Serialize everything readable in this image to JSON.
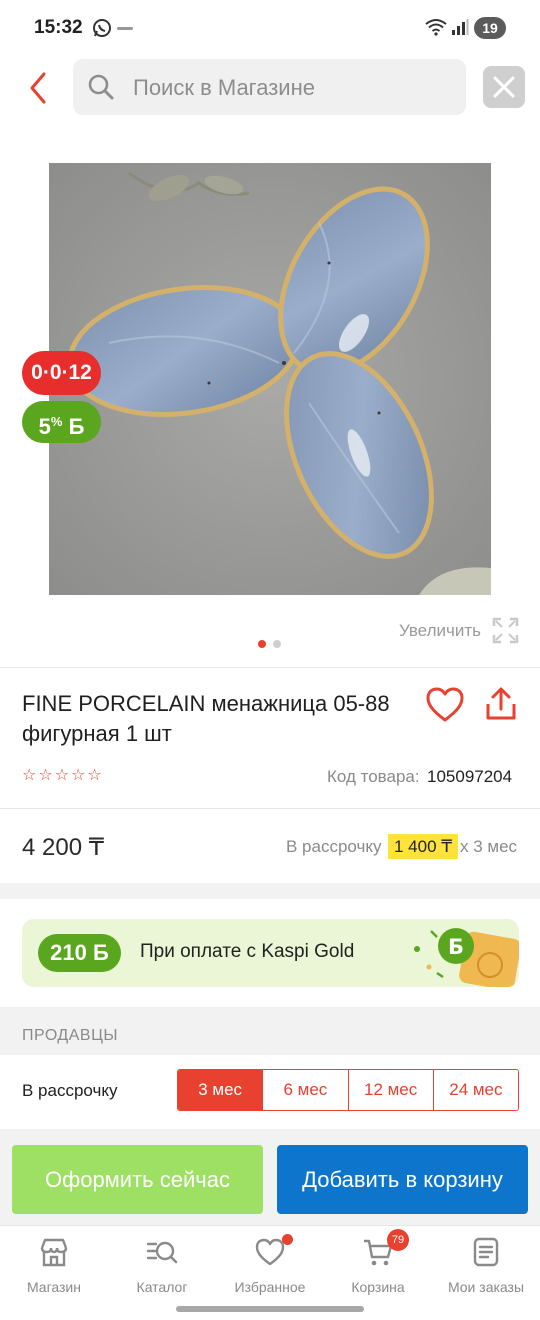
{
  "status_bar": {
    "time": "15:32",
    "battery": "19",
    "icons": [
      "whatsapp-icon",
      "wifi-icon",
      "signal-icon",
      "battery-icon"
    ]
  },
  "header": {
    "search_placeholder": "Поиск в Магазине",
    "icons": [
      "back-arrow-icon",
      "search-icon",
      "close-icon"
    ]
  },
  "gallery": {
    "badge_timer": "0·0·12",
    "badge_bonus_value": "5",
    "badge_bonus_suffix": "%",
    "badge_bonus_currency": "Б",
    "zoom_label": "Увеличить",
    "pages": 2,
    "active_page": 1
  },
  "product": {
    "title": "FINE PORCELAIN менажница 05-88 фигурная 1 шт",
    "rating": 0,
    "max_rating": 5,
    "sku_label": "Код товара:",
    "sku_value": "105097204"
  },
  "pricing": {
    "price": "4 200 ₸",
    "installment_label": "В рассрочку",
    "installment_amount": "1 400 ₸",
    "installment_term": "х 3 мес"
  },
  "kaspi_banner": {
    "bonus": "210 Б",
    "text": "При оплате с Kaspi Gold"
  },
  "sellers": {
    "title": "ПРОДАВЦЫ",
    "installment_label": "В рассрочку",
    "terms": [
      "3 мес",
      "6 мес",
      "12 мес",
      "24 мес"
    ],
    "active_term": "3 мес"
  },
  "actions": {
    "checkout_label": "Оформить сейчас",
    "add_to_cart_label": "Добавить в корзину"
  },
  "tabbar": {
    "items": [
      {
        "label": "Магазин",
        "icon": "store-icon"
      },
      {
        "label": "Каталог",
        "icon": "catalog-icon"
      },
      {
        "label": "Избранное",
        "icon": "heart-icon"
      },
      {
        "label": "Корзина",
        "icon": "cart-icon"
      },
      {
        "label": "Мои заказы",
        "icon": "orders-icon"
      }
    ],
    "cart_count": "79"
  },
  "colors": {
    "accent_red": "#e8412f",
    "bonus_green": "#5aa61e",
    "checkout_green": "#9ee064",
    "cart_blue": "#0e75cc",
    "installment_yellow": "#ffe33a"
  }
}
